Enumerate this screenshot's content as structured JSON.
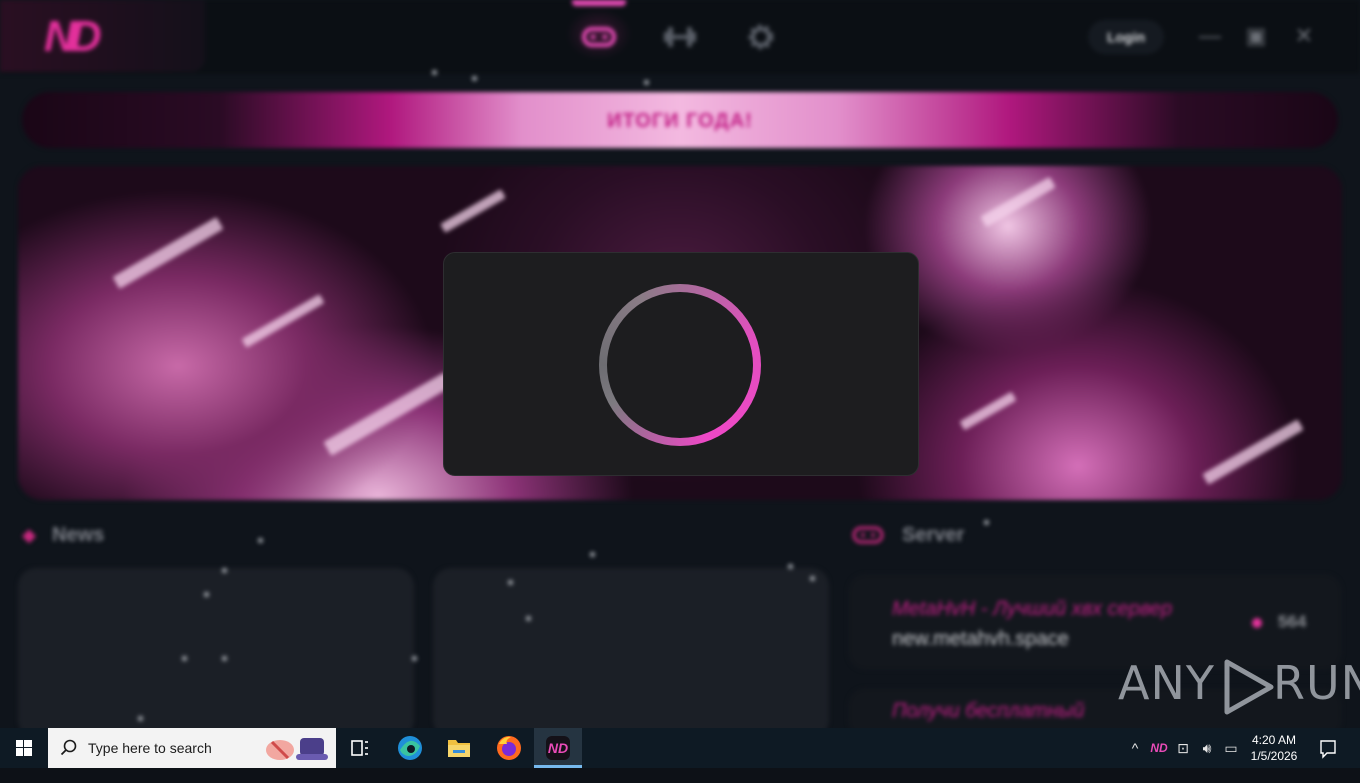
{
  "app": {
    "logo_text": "ND",
    "nav": [
      {
        "name": "gamepad-icon",
        "active": true
      },
      {
        "name": "dumbbell-icon",
        "active": false
      },
      {
        "name": "gear-icon",
        "active": false
      }
    ],
    "login_label": "Login",
    "banner_text": "ИТОГИ ГОДА!",
    "news_title": "News",
    "server_title": "Server",
    "servers": [
      {
        "name": "MetaHvH - Лучший хвх сервер",
        "address": "new.metahvh.space",
        "online": "564"
      },
      {
        "name": "Получи бесплатный",
        "address": "",
        "online": ""
      }
    ]
  },
  "modal": {
    "state": "loading",
    "spinner": "spinner-ring"
  },
  "watermark": {
    "left": "ANY",
    "right": "RUN"
  },
  "taskbar": {
    "search_placeholder": "Type here to search",
    "pinned": [
      "task-view-icon",
      "edge-icon",
      "file-explorer-icon",
      "firefox-icon",
      "nd-launcher-icon"
    ],
    "time": "4:20 AM",
    "date": "1/5/2026"
  },
  "colors": {
    "accent": "#e94bb7",
    "banner_text": "#c21f86",
    "bg": "#0f141b"
  }
}
